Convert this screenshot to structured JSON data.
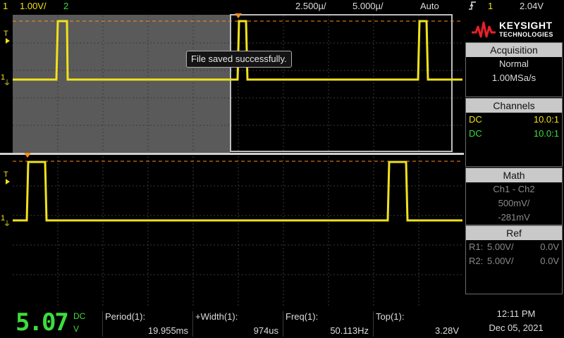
{
  "topbar": {
    "ch1_num": "1",
    "ch1_scale": "1.00V/",
    "ch2_num": "2",
    "timebase": "2.500µ/",
    "delay": "5.000µ/",
    "trigger_mode": "Auto",
    "trigger_icon": "rising-edge-icon",
    "trigger_ch": "1",
    "trigger_level": "2.04V"
  },
  "markers": {
    "t": "T",
    "ch1": "1",
    "ground": "⏚"
  },
  "toast": "File saved successfully.",
  "brand": {
    "name": "KEYSIGHT",
    "sub": "TECHNOLOGIES"
  },
  "acquisition": {
    "title": "Acquisition",
    "mode": "Normal",
    "rate": "1.00MSa/s"
  },
  "channels": {
    "title": "Channels",
    "rows": [
      {
        "coupling": "DC",
        "probe": "10.0:1"
      },
      {
        "coupling": "DC",
        "probe": "10.0:1"
      }
    ]
  },
  "math": {
    "title": "Math",
    "function": "Ch1 - Ch2",
    "scale": "500mV/",
    "offset": "-281mV"
  },
  "ref": {
    "title": "Ref",
    "rows": [
      {
        "name": "R1:",
        "scale": "5.00V/",
        "offset": "0.0V"
      },
      {
        "name": "R2:",
        "scale": "5.00V/",
        "offset": "0.0V"
      }
    ]
  },
  "dvm": {
    "value": "5.07",
    "coupling": "DC",
    "unit": "V"
  },
  "measurements": [
    {
      "label": "Period(1):",
      "value": "19.955ms"
    },
    {
      "label": "+Width(1):",
      "value": "974us"
    },
    {
      "label": "Freq(1):",
      "value": "50.113Hz"
    },
    {
      "label": "Top(1):",
      "value": "3.28V"
    }
  ],
  "clock": {
    "time": "12:11 PM",
    "date": "Dec 05, 2021"
  },
  "colors": {
    "ch1": "#f0e21b",
    "ch2": "#3ddc3d",
    "trigger": "#ff8c1a",
    "grid": "#3a3a3a"
  }
}
